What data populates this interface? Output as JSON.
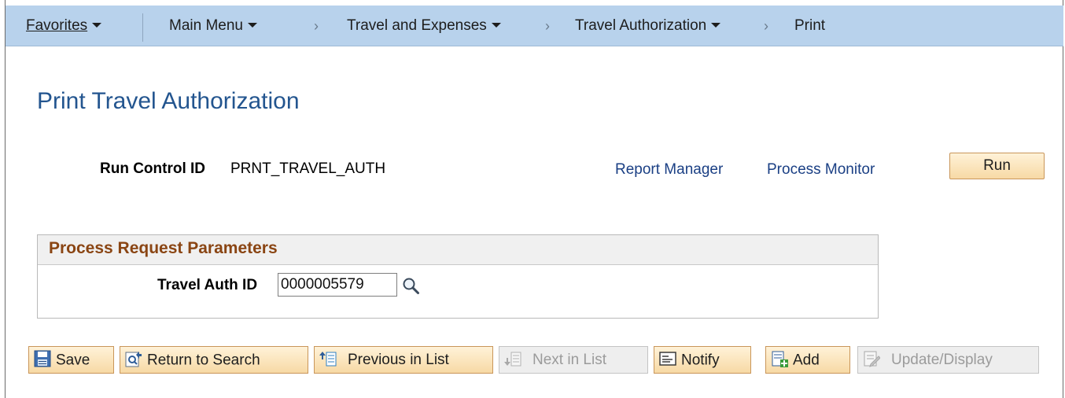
{
  "nav": {
    "favorites": "Favorites",
    "main_menu": "Main Menu",
    "travel_expenses": "Travel and Expenses",
    "travel_authorization": "Travel Authorization",
    "current": "Print",
    "separator": "›"
  },
  "page": {
    "title": "Print Travel Authorization",
    "run_control_label": "Run Control ID",
    "run_control_value": "PRNT_TRAVEL_AUTH",
    "report_manager": "Report Manager",
    "process_monitor": "Process Monitor",
    "run_label": "Run"
  },
  "group": {
    "title": "Process Request Parameters",
    "travel_auth_label": "Travel Auth ID",
    "travel_auth_value": "0000005579"
  },
  "toolbar": {
    "save": "Save",
    "return_to_search": "Return to Search",
    "previous_in_list": "Previous in List",
    "next_in_list": "Next in List",
    "notify": "Notify",
    "add": "Add",
    "update_display": "Update/Display"
  },
  "colors": {
    "navbar": "#b8d2ec",
    "title": "#23558f",
    "link": "#1a3f84",
    "group_title": "#8a4513",
    "button": "#f7d9a5"
  },
  "icons": [
    "caret-down-icon",
    "breadcrumb-separator",
    "magnifier-icon",
    "save-icon",
    "return-to-search-icon",
    "previous-in-list-icon",
    "next-in-list-icon",
    "notify-icon",
    "add-icon",
    "update-display-icon"
  ]
}
